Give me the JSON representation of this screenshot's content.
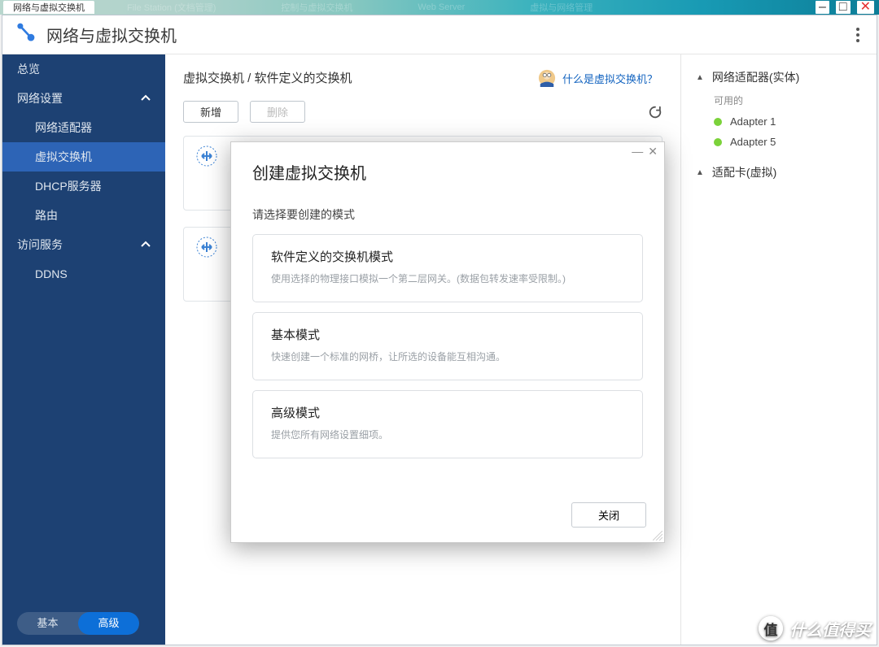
{
  "taskbar": {
    "active_task": "网络与虚拟交换机",
    "faint_tasks": [
      "",
      "File Station (文档管理)",
      "控制与虚拟交换机",
      "Web Server",
      "虚拟与网络管理"
    ]
  },
  "app": {
    "title": "网络与虚拟交换机"
  },
  "sidebar": {
    "overview": "总览",
    "section_network": "网络设置",
    "items": {
      "adapter": "网络适配器",
      "vswitch": "虚拟交换机",
      "dhcp": "DHCP服务器",
      "route": "路由"
    },
    "section_access": "访问服务",
    "access_items": {
      "ddns": "DDNS"
    },
    "mode_basic": "基本",
    "mode_advanced": "高级"
  },
  "center": {
    "breadcrumb_main": "虚拟交换机",
    "breadcrumb_sep": " / ",
    "breadcrumb_sub": "软件定义的交换机",
    "help_text": "什么是虚拟交换机？",
    "btn_add": "新增",
    "btn_delete": "删除"
  },
  "right": {
    "group_physical": "网络适配器(实体)",
    "available_label": "可用的",
    "adapters": [
      "Adapter 1",
      "Adapter 5"
    ],
    "group_virtual": "适配卡(虚拟)"
  },
  "modal": {
    "title": "创建虚拟交换机",
    "subtitle": "请选择要创建的模式",
    "options": [
      {
        "title": "软件定义的交换机模式",
        "desc": "使用选择的物理接口模拟一个第二层网关。(数据包转发速率受限制。)"
      },
      {
        "title": "基本模式",
        "desc": "快速创建一个标准的网桥，让所选的设备能互相沟通。"
      },
      {
        "title": "高级模式",
        "desc": "提供您所有网络设置细项。"
      }
    ],
    "close": "关闭"
  },
  "watermark": {
    "text": "什么值得买",
    "badge": "值"
  }
}
